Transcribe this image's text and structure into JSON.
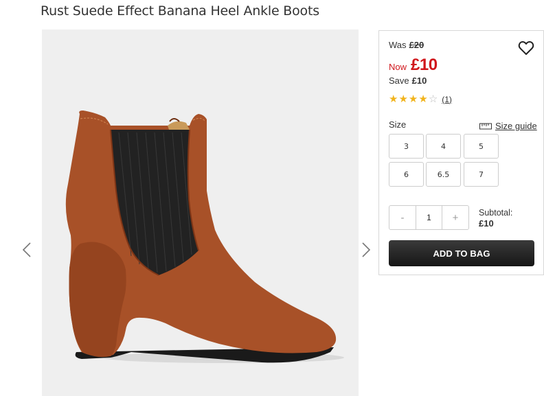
{
  "product": {
    "title": "Rust Suede Effect Banana Heel Ankle Boots"
  },
  "gallery": {
    "prev_icon": "chevron-left-icon",
    "next_icon": "chevron-right-icon"
  },
  "price": {
    "was_label": "Was",
    "was_value": "£20",
    "now_label": "Now",
    "now_value": "£10",
    "save_label": "Save",
    "save_value": "£10",
    "accent_color": "#d0161b"
  },
  "rating": {
    "stars": 4,
    "max": 5,
    "count": "(1)",
    "star_color": "#f1b31b"
  },
  "size": {
    "label": "Size",
    "guide_label": "Size guide",
    "guide_icon": "ruler-icon",
    "options": [
      "3",
      "4",
      "5",
      "6",
      "6.5",
      "7"
    ]
  },
  "quantity": {
    "decrement": "-",
    "value": "1",
    "increment": "+"
  },
  "subtotal": {
    "label": "Subtotal:",
    "value": "£10"
  },
  "cta": {
    "add_to_bag": "ADD TO BAG"
  },
  "wishlist_icon": "heart-icon"
}
